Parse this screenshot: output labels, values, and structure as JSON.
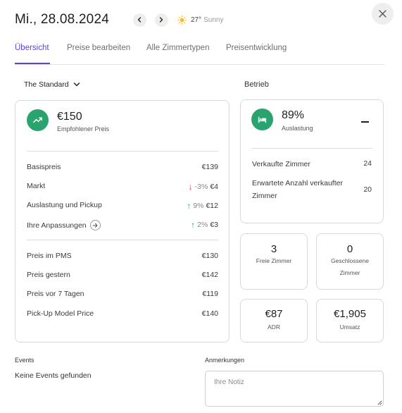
{
  "header": {
    "date": "Mi., 28.08.2024",
    "weather_temp": "27°",
    "weather_condition": "Sunny",
    "icons": [
      "chevron-left-icon",
      "chevron-right-icon",
      "sun-icon",
      "close-icon"
    ]
  },
  "tabs": [
    {
      "label": "Übersicht",
      "active": true
    },
    {
      "label": "Preise bearbeiten",
      "active": false
    },
    {
      "label": "Alle Zimmertypen",
      "active": false
    },
    {
      "label": "Preisentwicklung",
      "active": false
    }
  ],
  "room_select": {
    "value": "The Standard"
  },
  "right_section_label": "Betrieb",
  "price_card": {
    "value": "€150",
    "label": "Empfohlener Preis",
    "accent": "#2aa36f",
    "rows_top": [
      {
        "label": "Basispreis",
        "value": "€139"
      },
      {
        "label": "Markt",
        "arrow": "↓",
        "change": "-3%",
        "value": "€4"
      },
      {
        "label": "Auslastung und Pickup",
        "arrow": "↑",
        "change": "9%",
        "value": "€12"
      },
      {
        "label": "Ihre Anpassungen",
        "arrow": "↑",
        "change": "2%",
        "value": "€3"
      }
    ],
    "rows_bottom": [
      {
        "label": "Preis im PMS",
        "value": "€130"
      },
      {
        "label": "Preis gestern",
        "value": "€142"
      },
      {
        "label": "Preis vor 7 Tagen",
        "value": "€119"
      },
      {
        "label": "Pick-Up Model Price",
        "value": "€140"
      }
    ]
  },
  "occupancy_card": {
    "value": "89%",
    "label": "Auslastung",
    "rows": [
      {
        "label": "Verkaufte Zimmer",
        "value": "24"
      },
      {
        "label": "Erwartete Anzahl verkaufter Zimmer",
        "value": "20"
      }
    ]
  },
  "stats": [
    {
      "value": "3",
      "label": "Freie Zimmer"
    },
    {
      "value": "0",
      "label": "Geschlossene Zimmer"
    },
    {
      "value": "€87",
      "label": "ADR"
    },
    {
      "value": "€1,905",
      "label": "Umsatz"
    }
  ],
  "events": {
    "title": "Events",
    "empty_text": "Keine Events gefunden"
  },
  "notes": {
    "title": "Anmerkungen",
    "placeholder": "Ihre Notiz",
    "value": ""
  },
  "colors": {
    "accent_purple": "#5b43e6",
    "up_green": "#21a06a",
    "down_red": "#d93645"
  }
}
